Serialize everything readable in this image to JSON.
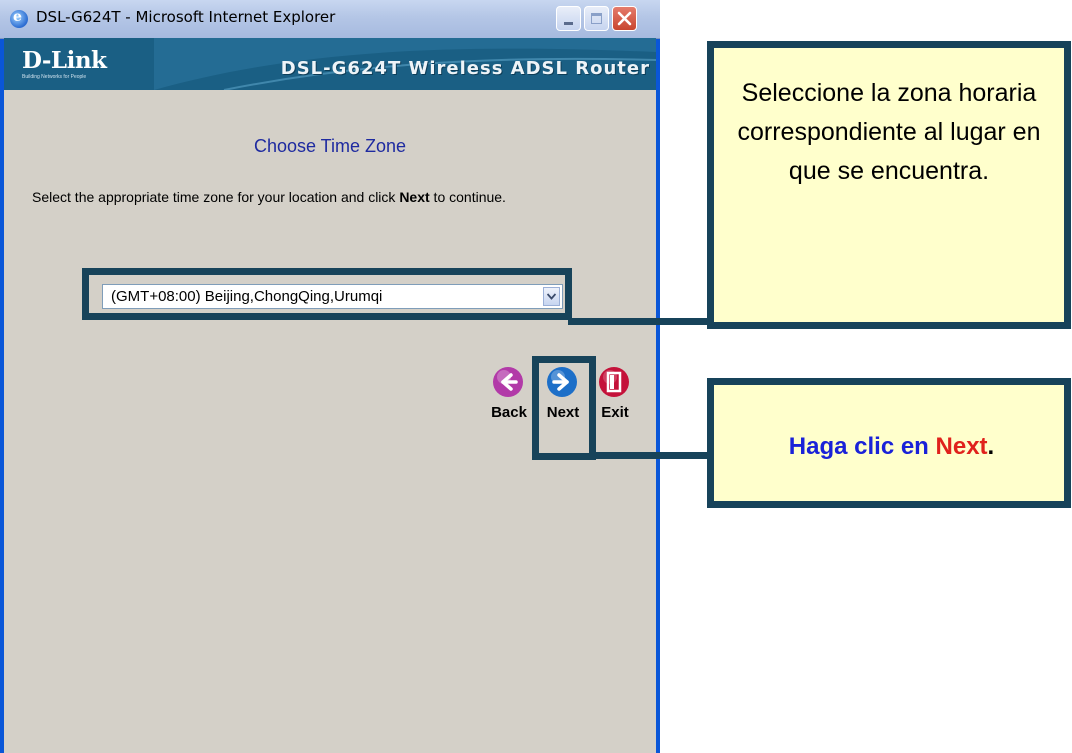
{
  "window": {
    "title": "DSL-G624T - Microsoft Internet Explorer"
  },
  "banner": {
    "logo": "D-Link",
    "tagline": "Building Networks for People",
    "product": "DSL-G624T Wireless ADSL Router"
  },
  "page": {
    "heading": "Choose Time Zone",
    "instruction_before": "Select the appropriate time zone for your location and click ",
    "instruction_bold": "Next",
    "instruction_after": " to continue.",
    "timezone_selected": "(GMT+08:00) Beijing,ChongQing,Urumqi"
  },
  "nav": {
    "back_label": "Back",
    "next_label": "Next",
    "exit_label": "Exit",
    "back_color": "#b23aa8",
    "next_color": "#1d6fc8",
    "exit_color": "#c4123a"
  },
  "callouts": {
    "timezone_text": "Seleccione la zona horaria correspondiente al lugar en que se encuentra.",
    "next_prefix": "Haga clic en ",
    "next_word": "Next",
    "next_suffix": "."
  },
  "colors": {
    "callout_border": "#17435a",
    "callout_fill": "#ffffcc",
    "banner": "#1a5f84",
    "heading": "#1e2aa0"
  }
}
